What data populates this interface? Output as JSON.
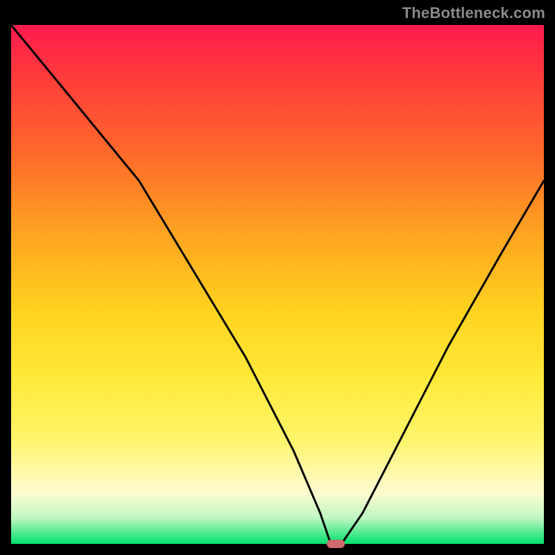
{
  "watermark": "TheBottleneck.com",
  "chart_data": {
    "type": "line",
    "title": "",
    "xlabel": "",
    "ylabel": "",
    "xlim": [
      0,
      100
    ],
    "ylim": [
      0,
      100
    ],
    "grid": false,
    "legend": false,
    "series": [
      {
        "name": "bottleneck-curve",
        "x": [
          0,
          12,
          24,
          34,
          44,
          53,
          58,
          60,
          62,
          66,
          72,
          82,
          92,
          100
        ],
        "values": [
          100,
          85,
          70,
          53,
          36,
          18,
          6,
          0,
          0,
          6,
          18,
          38,
          56,
          70
        ]
      }
    ],
    "marker": {
      "name": "optimal-point",
      "x": 61,
      "y": 0,
      "color": "#d06a6e"
    },
    "gradient_stops": [
      {
        "pos": 0,
        "color": "#ff1a4d"
      },
      {
        "pos": 10,
        "color": "#ff3b3b"
      },
      {
        "pos": 25,
        "color": "#ff6a2a"
      },
      {
        "pos": 40,
        "color": "#ffa321"
      },
      {
        "pos": 55,
        "color": "#ffd21f"
      },
      {
        "pos": 68,
        "color": "#ffe93a"
      },
      {
        "pos": 80,
        "color": "#fff56b"
      },
      {
        "pos": 90,
        "color": "#fffbd0"
      },
      {
        "pos": 95,
        "color": "#bff7c2"
      },
      {
        "pos": 100,
        "color": "#00e06b"
      }
    ]
  }
}
